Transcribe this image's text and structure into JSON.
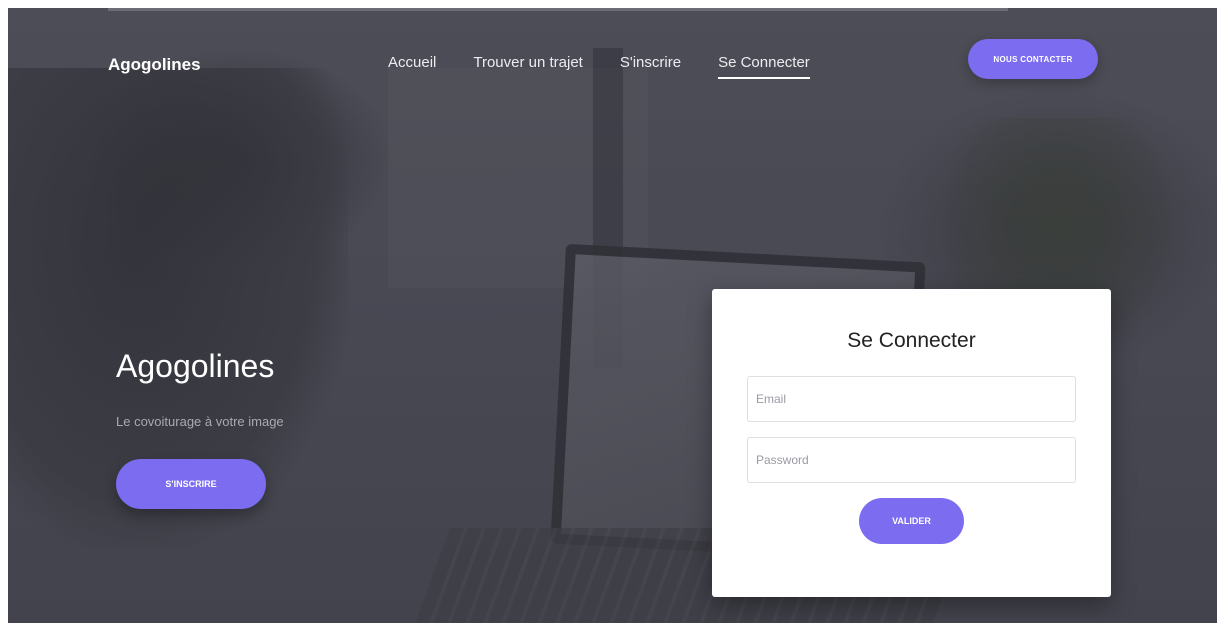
{
  "header": {
    "brand": "Agogolines",
    "nav": [
      {
        "label": "Accueil",
        "active": false
      },
      {
        "label": "Trouver un trajet",
        "active": false
      },
      {
        "label": "S'inscrire",
        "active": false
      },
      {
        "label": "Se Connecter",
        "active": true
      }
    ],
    "contact_label": "NOUS CONTACTER"
  },
  "hero": {
    "title": "Agogolines",
    "subtitle": "Le covoiturage à votre image",
    "signup_label": "S'INSCRIRE"
  },
  "login": {
    "title": "Se Connecter",
    "email_placeholder": "Email",
    "email_value": "",
    "password_placeholder": "Password",
    "password_value": "",
    "submit_label": "VALIDER"
  },
  "colors": {
    "accent": "#7b6cf0",
    "overlay": "#4a4a54",
    "card": "#ffffff"
  }
}
